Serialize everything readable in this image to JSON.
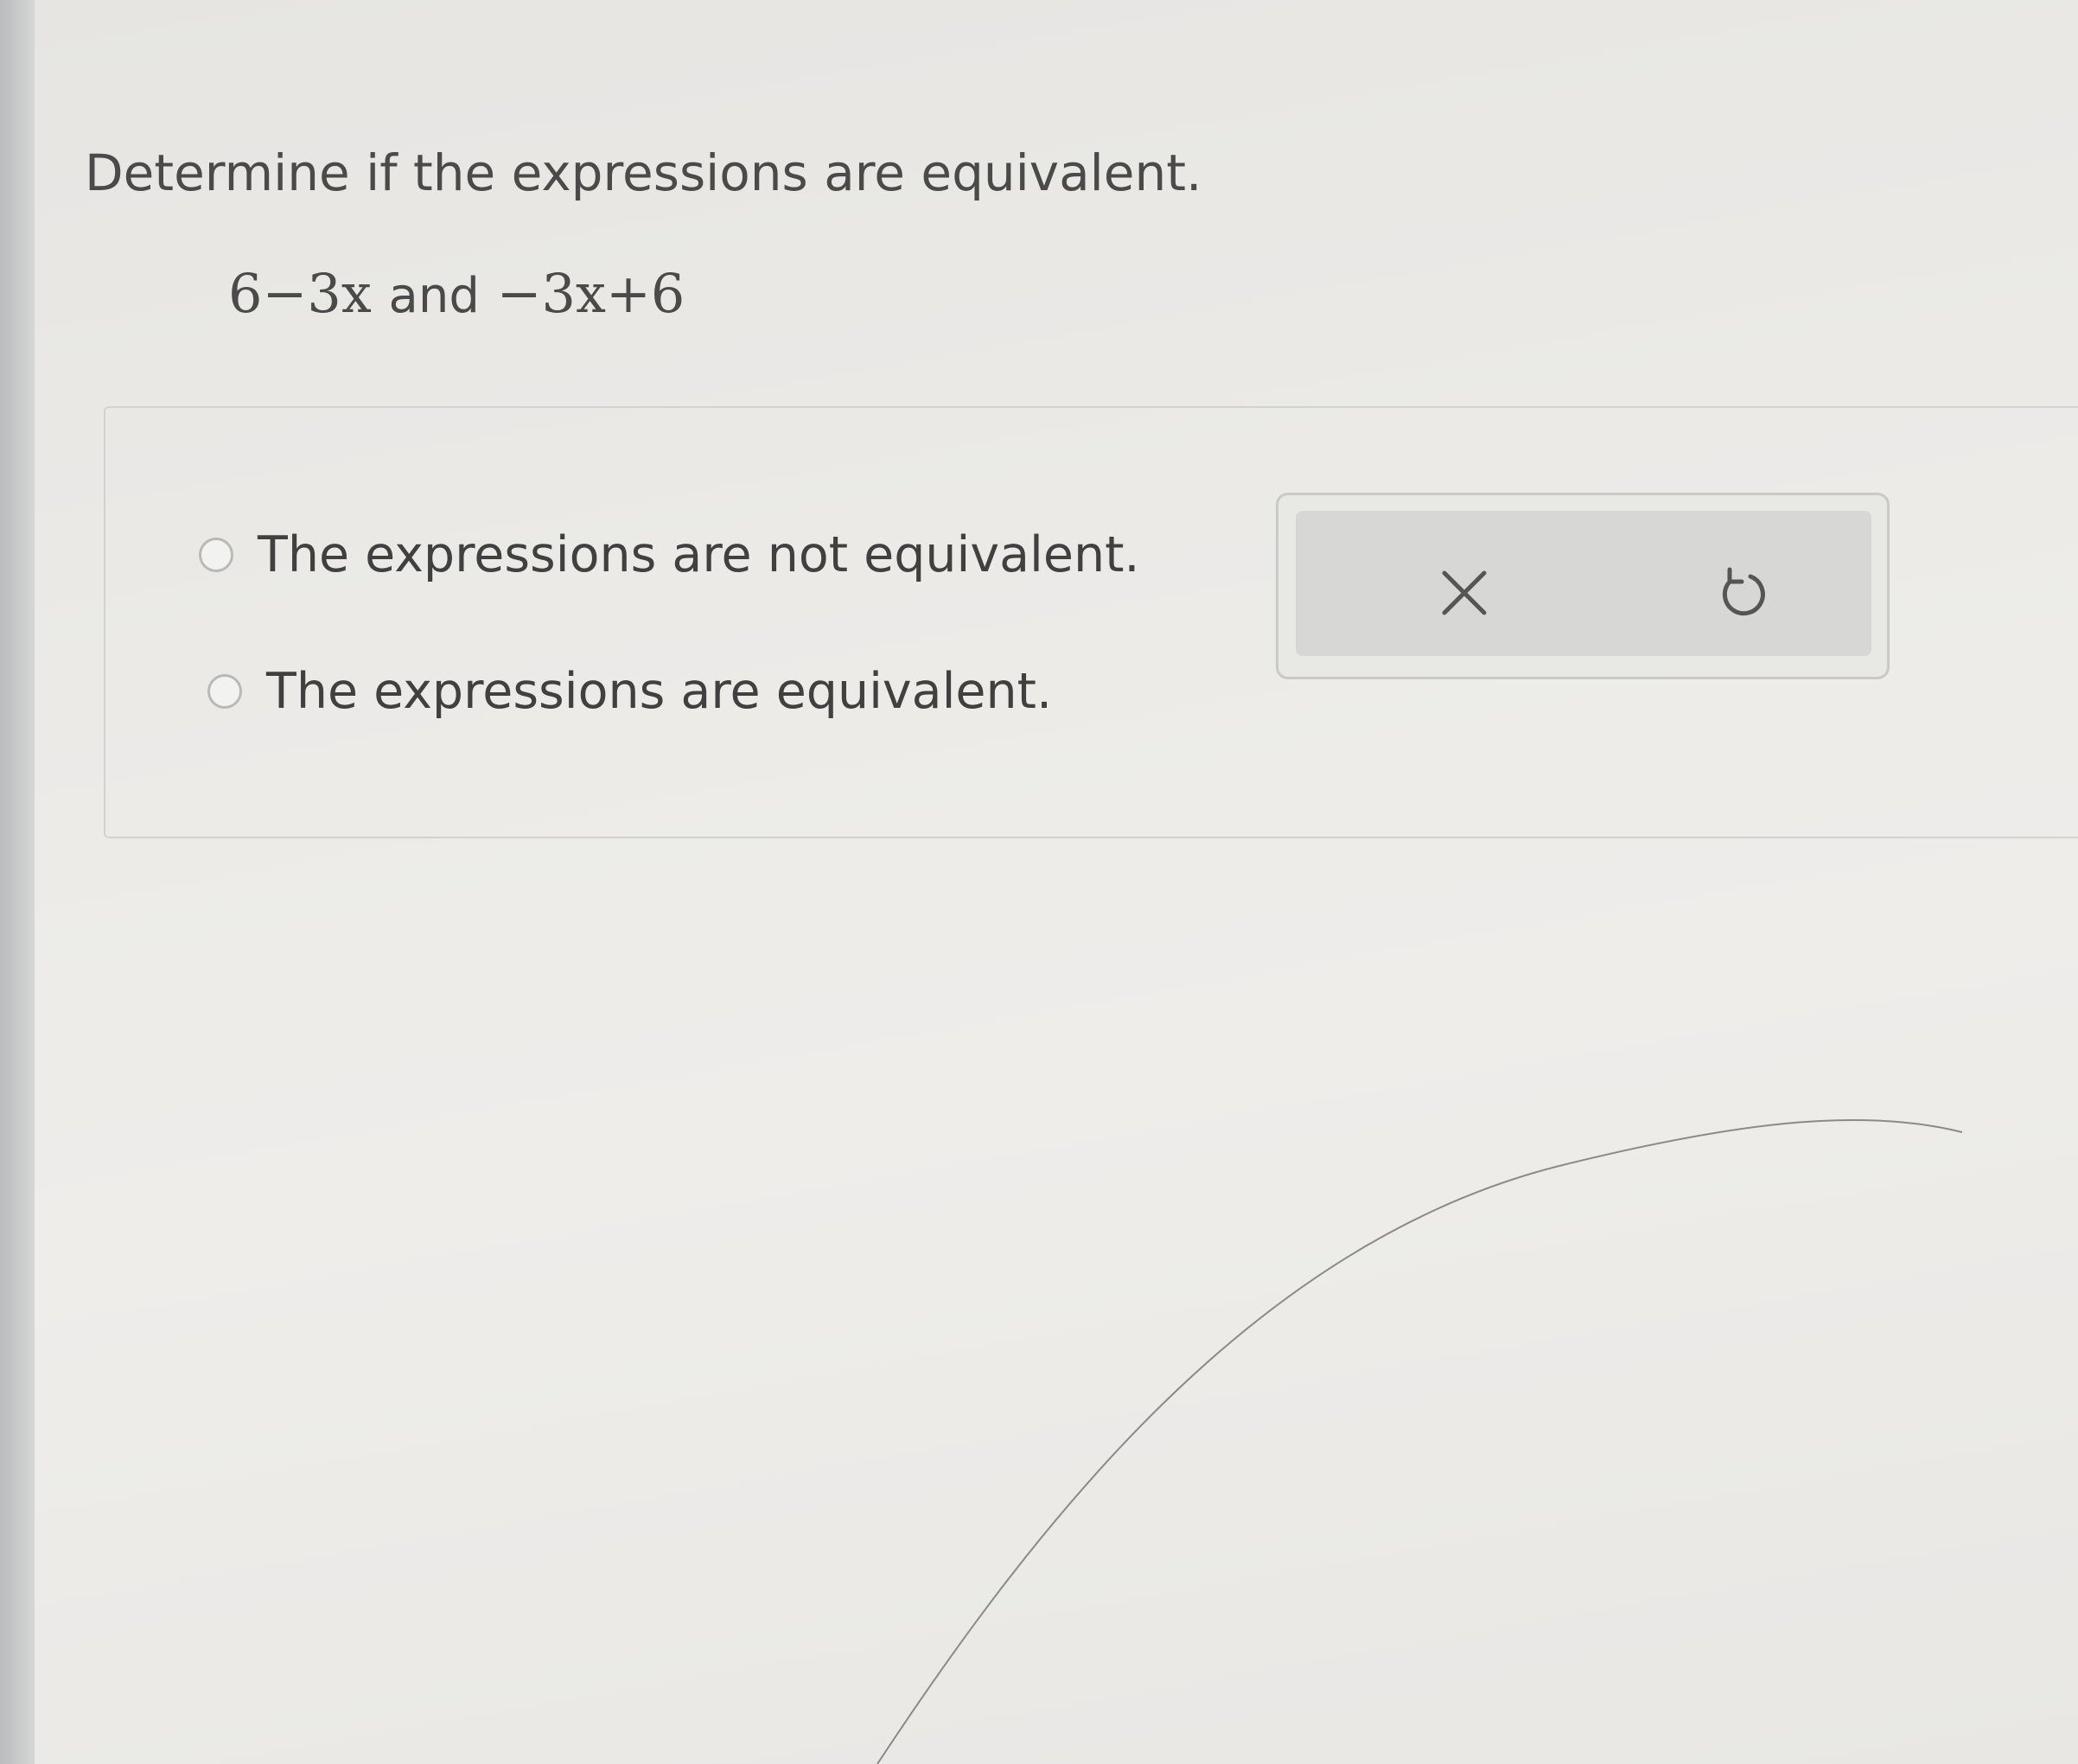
{
  "question": {
    "prompt": "Determine if the expressions are equivalent.",
    "expr_left": "6−3x",
    "join": "and",
    "expr_right": "−3x+6"
  },
  "choices": [
    {
      "label": "The expressions are not equivalent.",
      "selected": false
    },
    {
      "label": "The expressions are equivalent.",
      "selected": false
    }
  ],
  "toolbar": {
    "clear_icon": "x-icon",
    "undo_icon": "undo-icon"
  },
  "colors": {
    "text": "#404040",
    "panel_border": "#d2d2cf",
    "toolbar_bg": "#d7d8d6"
  }
}
